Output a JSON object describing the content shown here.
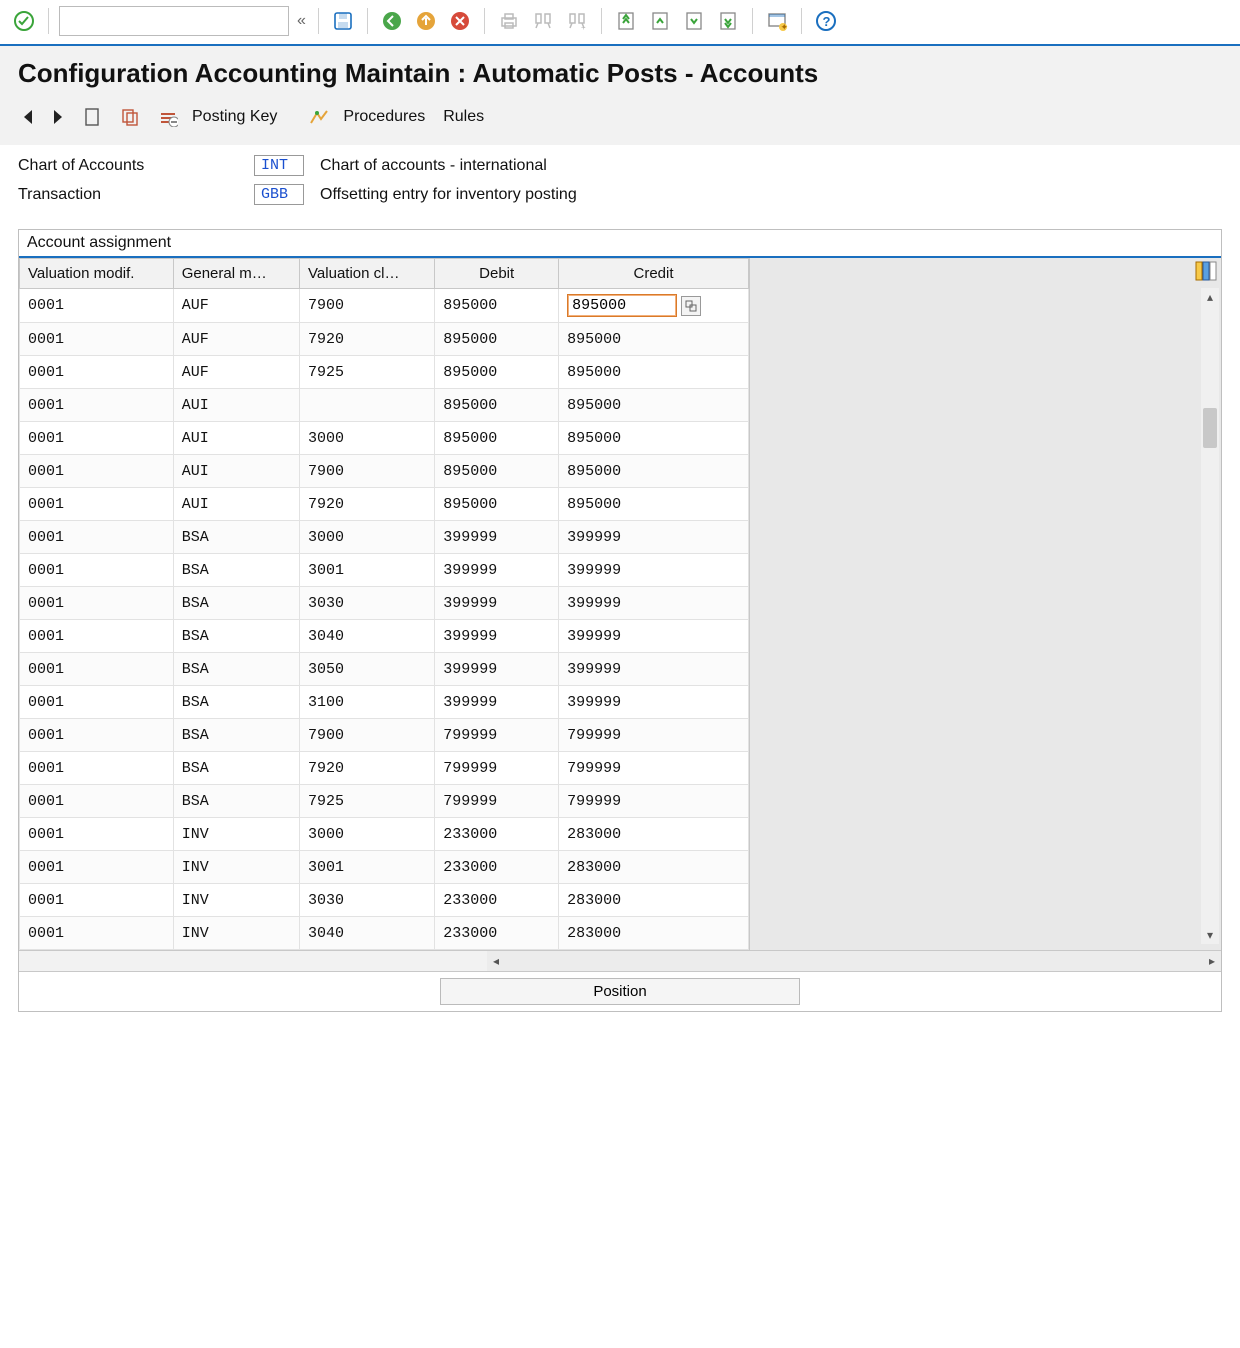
{
  "title": "Configuration Accounting Maintain : Automatic Posts - Accounts",
  "toolbar": {
    "posting_key_label": "Posting Key",
    "procedures_label": "Procedures",
    "rules_label": "Rules"
  },
  "header": {
    "chart_label": "Chart of Accounts",
    "chart_code": "INT",
    "chart_desc": "Chart of accounts - international",
    "trans_label": "Transaction",
    "trans_code": "GBB",
    "trans_desc": "Offsetting entry for inventory posting"
  },
  "table": {
    "title": "Account assignment",
    "columns": {
      "valuation_modif": "Valuation modif.",
      "general_mod": "General m…",
      "valuation_class": "Valuation cl…",
      "debit": "Debit",
      "credit": "Credit"
    },
    "rows": [
      {
        "vm": "0001",
        "gm": "AUF",
        "vc": "7900",
        "debit": "895000",
        "credit": "895000",
        "active": true
      },
      {
        "vm": "0001",
        "gm": "AUF",
        "vc": "7920",
        "debit": "895000",
        "credit": "895000"
      },
      {
        "vm": "0001",
        "gm": "AUF",
        "vc": "7925",
        "debit": "895000",
        "credit": "895000"
      },
      {
        "vm": "0001",
        "gm": "AUI",
        "vc": "",
        "debit": "895000",
        "credit": "895000"
      },
      {
        "vm": "0001",
        "gm": "AUI",
        "vc": "3000",
        "debit": "895000",
        "credit": "895000"
      },
      {
        "vm": "0001",
        "gm": "AUI",
        "vc": "7900",
        "debit": "895000",
        "credit": "895000"
      },
      {
        "vm": "0001",
        "gm": "AUI",
        "vc": "7920",
        "debit": "895000",
        "credit": "895000"
      },
      {
        "vm": "0001",
        "gm": "BSA",
        "vc": "3000",
        "debit": "399999",
        "credit": "399999"
      },
      {
        "vm": "0001",
        "gm": "BSA",
        "vc": "3001",
        "debit": "399999",
        "credit": "399999"
      },
      {
        "vm": "0001",
        "gm": "BSA",
        "vc": "3030",
        "debit": "399999",
        "credit": "399999"
      },
      {
        "vm": "0001",
        "gm": "BSA",
        "vc": "3040",
        "debit": "399999",
        "credit": "399999"
      },
      {
        "vm": "0001",
        "gm": "BSA",
        "vc": "3050",
        "debit": "399999",
        "credit": "399999"
      },
      {
        "vm": "0001",
        "gm": "BSA",
        "vc": "3100",
        "debit": "399999",
        "credit": "399999"
      },
      {
        "vm": "0001",
        "gm": "BSA",
        "vc": "7900",
        "debit": "799999",
        "credit": "799999"
      },
      {
        "vm": "0001",
        "gm": "BSA",
        "vc": "7920",
        "debit": "799999",
        "credit": "799999"
      },
      {
        "vm": "0001",
        "gm": "BSA",
        "vc": "7925",
        "debit": "799999",
        "credit": "799999"
      },
      {
        "vm": "0001",
        "gm": "INV",
        "vc": "3000",
        "debit": "233000",
        "credit": "283000"
      },
      {
        "vm": "0001",
        "gm": "INV",
        "vc": "3001",
        "debit": "233000",
        "credit": "283000"
      },
      {
        "vm": "0001",
        "gm": "INV",
        "vc": "3030",
        "debit": "233000",
        "credit": "283000"
      },
      {
        "vm": "0001",
        "gm": "INV",
        "vc": "3040",
        "debit": "233000",
        "credit": "283000"
      }
    ],
    "position_label": "Position"
  }
}
